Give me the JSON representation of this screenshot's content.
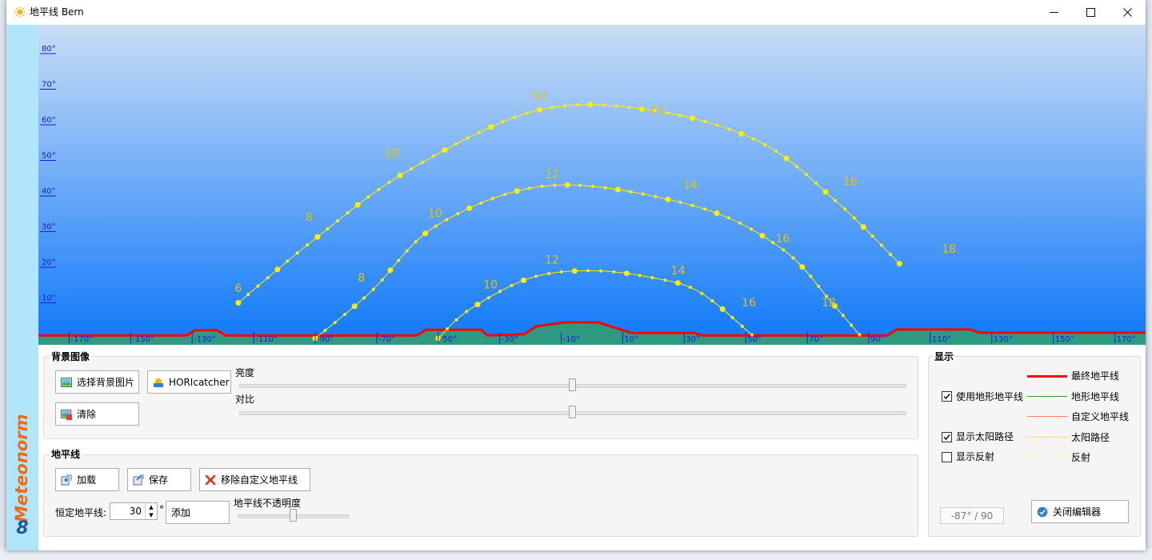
{
  "window": {
    "title": "地平线 Bern",
    "controls": {
      "minimize": "—",
      "maximize": "☐",
      "close": "✕"
    }
  },
  "sidebar": {
    "brand": "Meteonorm",
    "version": "8"
  },
  "chart": {
    "y_ticks": [
      "10°",
      "20°",
      "30°",
      "40°",
      "50°",
      "60°",
      "70°",
      "80°"
    ],
    "x_ticks": [
      "-170°",
      "-150°",
      "-130°",
      "-110°",
      "-90°",
      "-70°",
      "-50°",
      "-30°",
      "-10°",
      "10°",
      "30°",
      "50°",
      "70°",
      "90°",
      "110°",
      "130°",
      "150°",
      "170°"
    ],
    "colors": {
      "sky_top": "#c9ddf5",
      "sky_bottom": "#0e78fa",
      "ground": "#2f9a82",
      "horizon": "#ff0000",
      "sun_path": "#ffee00",
      "labels": "#e6c300"
    }
  },
  "chart_data": {
    "type": "line",
    "xlabel": "",
    "ylabel": "",
    "xlim": [
      -180,
      180
    ],
    "ylim": [
      0,
      88
    ],
    "x_unit": "azimuth degrees",
    "y_unit": "elevation degrees",
    "series": [
      {
        "hour_labels": [
          "6",
          "8",
          "10",
          "12",
          "14",
          "16",
          "18"
        ],
        "points": [
          [
            -115,
            10
          ],
          [
            -90,
            28
          ],
          [
            -60,
            47
          ],
          [
            -18,
            64
          ],
          [
            20,
            64
          ],
          [
            55,
            55
          ],
          [
            80,
            38
          ],
          [
            100,
            21
          ]
        ],
        "label_points": [
          [
            -115,
            13
          ],
          [
            -92,
            33
          ],
          [
            -65,
            51
          ],
          [
            -17,
            67
          ],
          [
            21,
            63
          ],
          [
            84,
            43
          ],
          [
            116,
            24
          ]
        ]
      },
      {
        "hour_labels": [
          "8",
          "10",
          "12",
          "14",
          "16",
          "18"
        ],
        "points": [
          [
            -90,
            0
          ],
          [
            -72,
            13
          ],
          [
            -50,
            32
          ],
          [
            -13,
            43
          ],
          [
            34,
            37
          ],
          [
            62,
            25
          ],
          [
            78,
            10
          ],
          [
            87,
            1
          ]
        ],
        "label_points": [
          [
            -75,
            16
          ],
          [
            -51,
            34
          ],
          [
            -13,
            45
          ],
          [
            32,
            42
          ],
          [
            62,
            27
          ],
          [
            77,
            9
          ]
        ]
      },
      {
        "hour_labels": [
          "10",
          "12",
          "14",
          "16"
        ],
        "points": [
          [
            -50,
            0
          ],
          [
            -40,
            8
          ],
          [
            -20,
            17
          ],
          [
            0,
            19
          ],
          [
            20,
            17
          ],
          [
            35,
            13
          ],
          [
            52,
            1
          ]
        ],
        "label_points": [
          [
            -33,
            14
          ],
          [
            -13,
            21
          ],
          [
            28,
            18
          ],
          [
            51,
            9
          ]
        ]
      }
    ],
    "horizon": {
      "name": "最终地平线",
      "points": [
        [
          -180,
          0.8
        ],
        [
          -132,
          0.8
        ],
        [
          -129,
          2.3
        ],
        [
          -122,
          2.3
        ],
        [
          -119,
          0.8
        ],
        [
          -57,
          0.8
        ],
        [
          -54,
          2.4
        ],
        [
          -36,
          2.4
        ],
        [
          -34,
          0.8
        ],
        [
          -22,
          1.2
        ],
        [
          -18,
          3.4
        ],
        [
          -9,
          4.5
        ],
        [
          2,
          4.5
        ],
        [
          6,
          3.4
        ],
        [
          13,
          1.5
        ],
        [
          33,
          1.5
        ],
        [
          36,
          0.8
        ],
        [
          96,
          0.8
        ],
        [
          99,
          2.5
        ],
        [
          123,
          2.5
        ],
        [
          126,
          1.6
        ],
        [
          180,
          1.6
        ]
      ]
    },
    "grid": false,
    "legend": "none"
  },
  "background": {
    "title": "背景图像",
    "select_label": "选择背景图片",
    "horicatcher_label": "HORIcatcher",
    "clear_label": "清除",
    "brightness_label": "亮度",
    "contrast_label": "对比",
    "brightness_value": 0.5,
    "contrast_value": 0.5
  },
  "horizon_panel": {
    "title": "地平线",
    "load_label": "加载",
    "save_label": "保存",
    "remove_label": "移除自定义地平线",
    "fixed_label": "恒定地平线:",
    "fixed_value": "30",
    "degree_symbol": "°",
    "add_label": "添加",
    "opacity_label": "地平线不透明度",
    "opacity_value": 0.5
  },
  "display": {
    "title": "显示",
    "use_terrain_label": "使用地形地平线",
    "show_sun_label": "显示太阳路径",
    "show_reflection_label": "显示反射",
    "legend_final": "最终地平线",
    "legend_terrain": "地形地平线",
    "legend_custom": "自定义地平线",
    "legend_sun": "太阳路径",
    "legend_reflection": "反射",
    "position_readout": "-87° / 90",
    "close_editor_label": "关闭编辑器",
    "colors": {
      "final": "#ff0000",
      "terrain": "#2aa02a",
      "custom": "#ff7f50",
      "sun": "#ffee00",
      "reflection": "#fff9b0"
    }
  }
}
